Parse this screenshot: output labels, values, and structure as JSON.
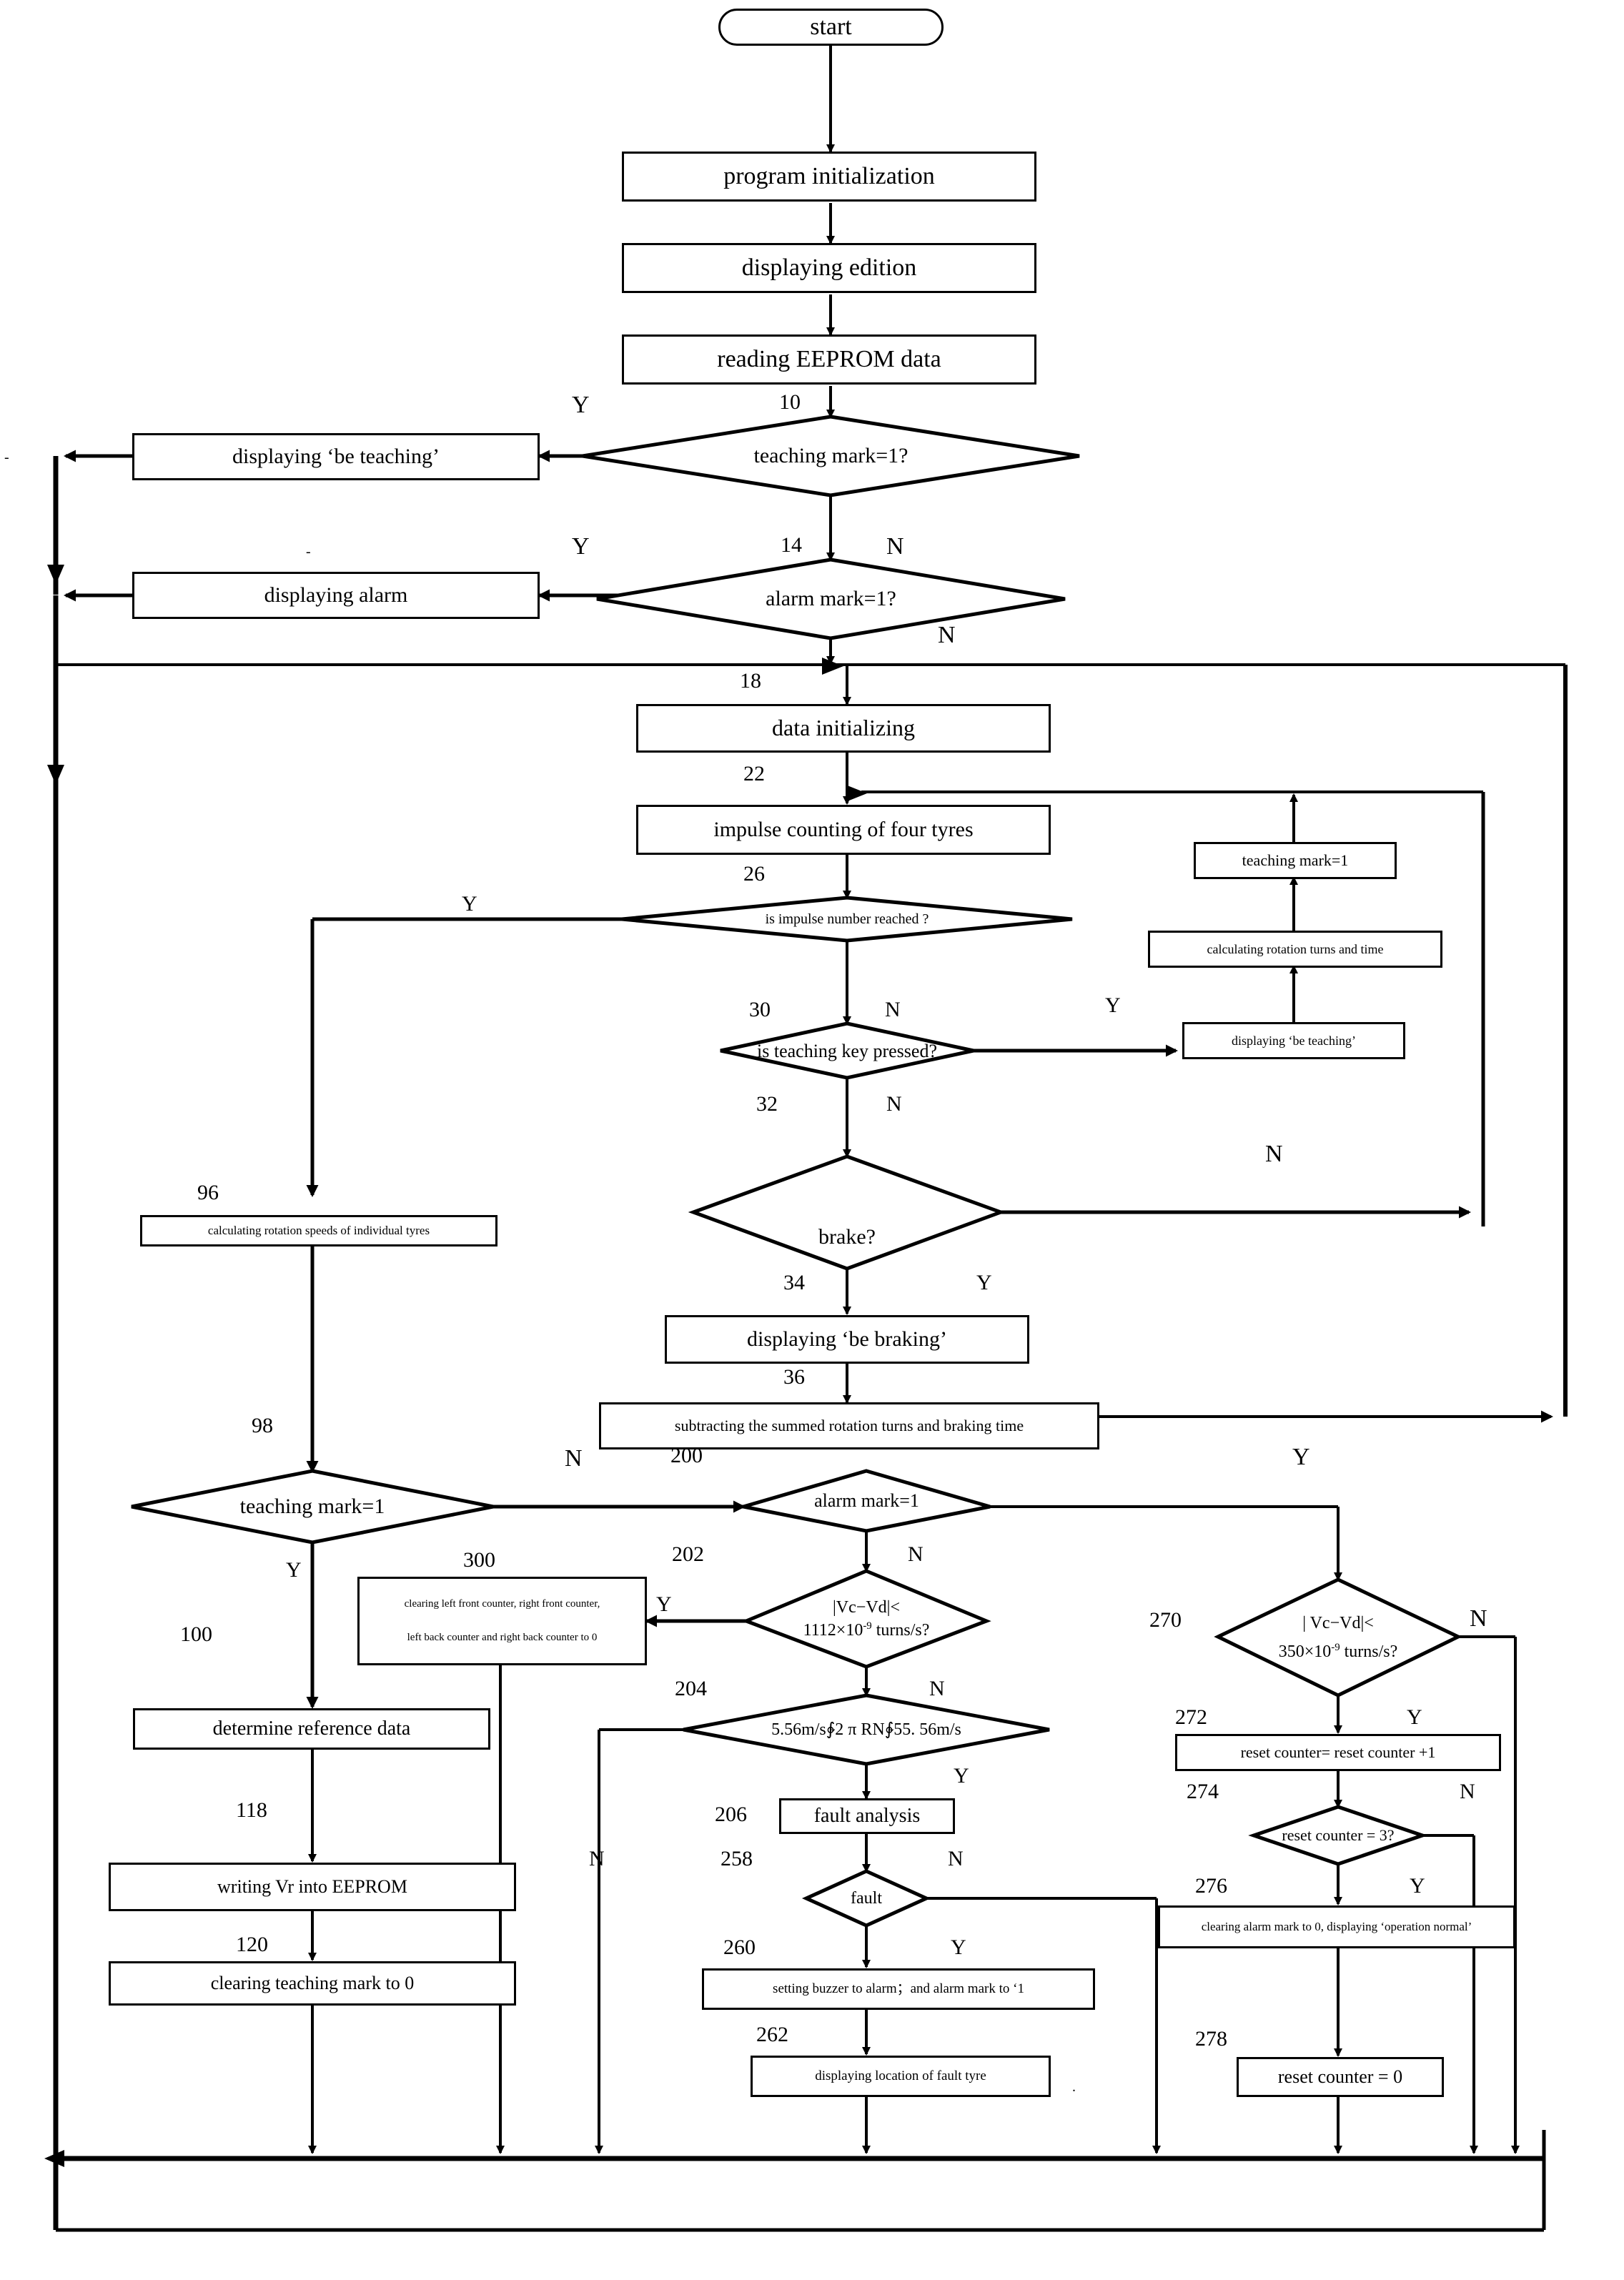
{
  "diagram": {
    "title": "tyre pressure monitoring control program flowchart",
    "type": "flowchart"
  },
  "nodes": {
    "start": "start",
    "program_init": "program initialization",
    "displaying_edition": "displaying edition",
    "reading_eeprom": "reading EEPROM data",
    "teaching_mark_q": "teaching mark=1?",
    "displaying_be_teaching_1": "displaying ‘be teaching’",
    "alarm_mark_q": "alarm mark=1?",
    "displaying_alarm": "displaying alarm",
    "data_initializing": "data initializing",
    "impulse_counting": "impulse counting of four tyres",
    "impulse_reached_q": "is impulse number reached ?",
    "teaching_mark_set": "teaching mark=1",
    "calc_rotation_turns": "calculating rotation turns and time",
    "teaching_key_q": "is teaching key pressed?",
    "displaying_be_teaching_2": "displaying  ‘be teaching’",
    "brake_q": "brake?",
    "displaying_be_braking": "displaying ‘be braking’",
    "subtracting": "subtracting the summed rotation turns and braking time",
    "calc_rotation_speeds": "calculating rotation speeds of individual tyres",
    "teaching_mark_2": "teaching mark=1",
    "alarm_mark_2": "alarm mark=1",
    "clearing_counters_l1": "clearing left front counter, right front counter,",
    "clearing_counters_l2": "left back counter and right back counter to 0",
    "determine_reference": "determine reference data",
    "writing_vr": "writing Vr into EEPROM",
    "clearing_teaching_mark": "clearing teaching mark to 0",
    "vcvd_1112_l1": "|Vc−Vd|<",
    "vcvd_1112_l2_a": "1112×10",
    "vcvd_1112_l2_sup": "-9",
    "vcvd_1112_l2_b": " turns/s?",
    "speed_range": "5.56m/s∲2 π RN∲55. 56m/s",
    "fault_analysis": "fault analysis",
    "fault_q": "fault",
    "setting_buzzer": "setting buzzer to alarm；and alarm mark to ‘1",
    "displaying_fault_tyre": "displaying location of fault tyre",
    "vcvd_350_l1": "| Vc−Vd|<",
    "vcvd_350_l2_a": "350×10",
    "vcvd_350_l2_sup": "-9",
    "vcvd_350_l2_b": " turns/s?",
    "reset_counter_inc": "reset counter= reset counter +1",
    "reset_counter_3_q": "reset counter = 3?",
    "clearing_alarm_mark": "clearing alarm mark to 0, displaying ‘operation normal’",
    "reset_counter_zero": "reset counter = 0"
  },
  "step_numbers": {
    "n10": "10",
    "n14": "14",
    "n18": "18",
    "n22": "22",
    "n26": "26",
    "n30": "30",
    "n32": "32",
    "n34": "34",
    "n36": "36",
    "n96": "96",
    "n98": "98",
    "n100": "100",
    "n118": "118",
    "n120": "120",
    "n200": "200",
    "n202": "202",
    "n204": "204",
    "n206": "206",
    "n258": "258",
    "n260": "260",
    "n262": "262",
    "n270": "270",
    "n272": "272",
    "n274": "274",
    "n276": "276",
    "n278": "278",
    "n300": "300"
  },
  "branch_labels": {
    "y10": "Y",
    "n10": "N",
    "y14": "Y",
    "n14": "N",
    "y26": "Y",
    "n26": "N",
    "y30": "Y",
    "n30": "N",
    "n32": "N",
    "y32": "Y",
    "n98": "N",
    "y98": "Y",
    "n200": "N",
    "y200": "Y",
    "y202": "Y",
    "n202": "N",
    "n204": "N",
    "y204": "Y",
    "n258": "N",
    "y258": "Y",
    "n270": "N",
    "y270": "Y",
    "n274": "N",
    "y274": "Y"
  },
  "colors": {
    "stroke": "#000000",
    "fill": "#ffffff"
  }
}
